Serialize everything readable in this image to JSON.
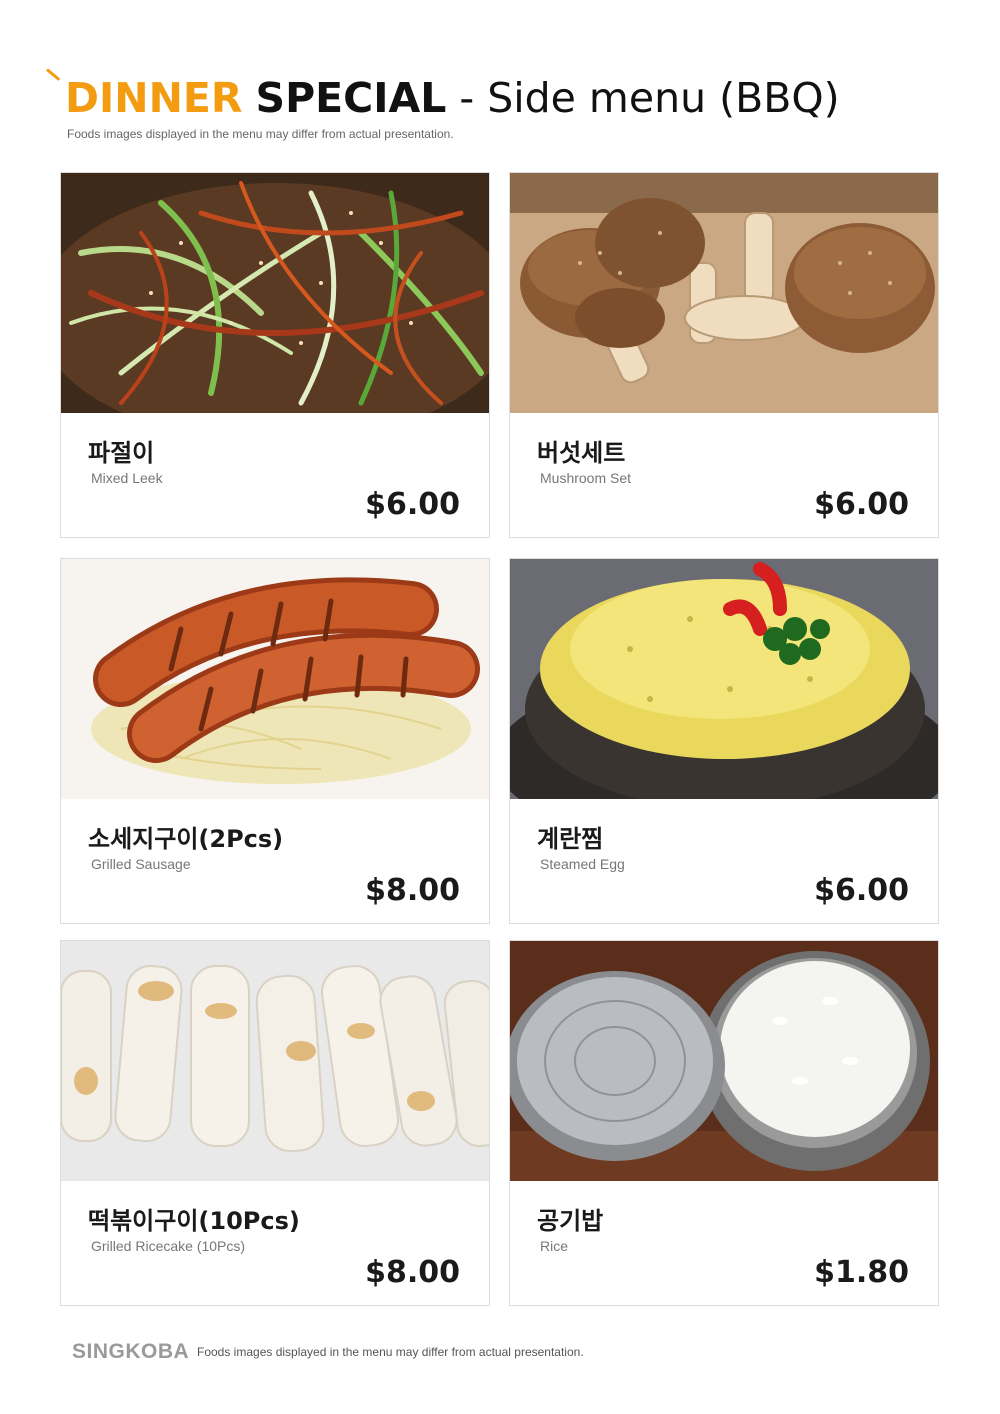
{
  "header": {
    "dinner": "DINNER",
    "special": "SPECIAL",
    "rest": "- Side menu (BBQ)",
    "subtitle": "Foods images displayed in the menu may differ from actual presentation."
  },
  "accent_color": "#f39c12",
  "items": [
    {
      "name_ko": "파절이",
      "name_en": "Mixed Leek",
      "price": "$6.00",
      "image": "leek-salad"
    },
    {
      "name_ko": "버섯세트",
      "name_en": "Mushroom Set",
      "price": "$6.00",
      "image": "mushrooms"
    },
    {
      "name_ko": "소세지구이(2Pcs)",
      "name_en": "Grilled Sausage",
      "price": "$8.00",
      "image": "sausages"
    },
    {
      "name_ko": "계란찜",
      "name_en": "Steamed Egg",
      "price": "$6.00",
      "image": "steamed-egg"
    },
    {
      "name_ko": "떡볶이구이(10Pcs)",
      "name_en": "Grilled Ricecake (10Pcs)",
      "price": "$8.00",
      "image": "rice-cakes"
    },
    {
      "name_ko": "공기밥",
      "name_en": "Rice",
      "price": "$1.80",
      "image": "rice-bowl"
    }
  ],
  "footer": {
    "brand": "SINGKOBA",
    "note": "Foods images displayed in the menu may differ from actual presentation."
  }
}
